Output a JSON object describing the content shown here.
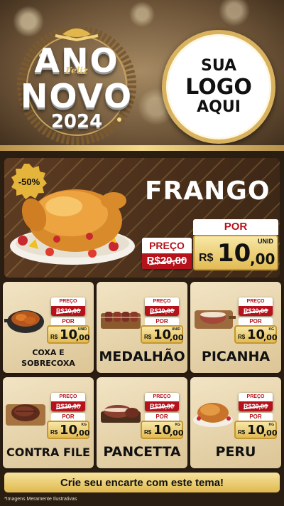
{
  "header": {
    "emblem": {
      "line1": "ANO",
      "script": "Feliz",
      "line2": "NOVO",
      "year": "2024"
    },
    "logo": {
      "line1": "SUA",
      "line2": "LOGO",
      "line3": "AQUI"
    }
  },
  "featured": {
    "badge": "-50%",
    "name": "FRANGO",
    "preco_label": "PREÇO",
    "old_price": "R$20,00",
    "por_label": "POR",
    "currency": "R$",
    "price_int": "10",
    "price_cents": ",00",
    "unit": "UNID"
  },
  "products": [
    {
      "name": "COXA E SOBRECOXA",
      "preco_label": "PREÇO",
      "old_price": "R$20,00",
      "por_label": "POR",
      "currency": "R$",
      "price_int": "10",
      "price_cents": ",00",
      "unit": "UNID"
    },
    {
      "name": "MEDALHÃO",
      "preco_label": "PREÇO",
      "old_price": "R$20,00",
      "por_label": "POR",
      "currency": "R$",
      "price_int": "10",
      "price_cents": ",00",
      "unit": "UNID"
    },
    {
      "name": "PICANHA",
      "preco_label": "PREÇO",
      "old_price": "R$20,00",
      "por_label": "POR",
      "currency": "R$",
      "price_int": "10",
      "price_cents": ",00",
      "unit": "KG"
    },
    {
      "name": "CONTRA FILE",
      "preco_label": "PREÇO",
      "old_price": "R$20,00",
      "por_label": "POR",
      "currency": "R$",
      "price_int": "10",
      "price_cents": ",00",
      "unit": "KG"
    },
    {
      "name": "PANCETTA",
      "preco_label": "PREÇO",
      "old_price": "R$20,00",
      "por_label": "POR",
      "currency": "R$",
      "price_int": "10",
      "price_cents": ",00",
      "unit": "KG"
    },
    {
      "name": "PERU",
      "preco_label": "PREÇO",
      "old_price": "R$20,00",
      "por_label": "POR",
      "currency": "R$",
      "price_int": "10",
      "price_cents": ",00",
      "unit": "KG"
    }
  ],
  "footer": {
    "cta": "Crie seu encarte com este tema!",
    "disclaimer": "*Imagens Meramente Ilustrativas"
  },
  "colors": {
    "accent_red": "#b5121b",
    "gold": "#e2bb54",
    "background": "#2a1d12"
  }
}
